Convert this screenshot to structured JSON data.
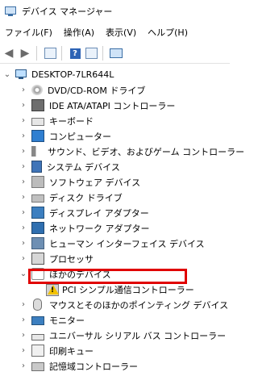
{
  "window": {
    "title": "デバイス マネージャー",
    "icon": "device-manager-icon"
  },
  "menu": [
    "ファイル(F)",
    "操作(A)",
    "表示(V)",
    "ヘルプ(H)"
  ],
  "toolbar": {
    "back_icon": "back-arrow-icon",
    "forward_icon": "forward-arrow-icon",
    "view_icon": "properties-icon",
    "help_label": "?",
    "scan_icon": "scan-hardware-icon",
    "monitor_icon": "monitor-icon"
  },
  "tree": {
    "root": "DESKTOP-7LR644L",
    "categories": [
      {
        "label": "DVD/CD-ROM ドライブ",
        "icon": "dvd-drive-icon"
      },
      {
        "label": "IDE ATA/ATAPI コントローラー",
        "icon": "ide-controller-icon"
      },
      {
        "label": "キーボード",
        "icon": "keyboard-icon"
      },
      {
        "label": "コンピューター",
        "icon": "computer-icon"
      },
      {
        "label": "サウンド、ビデオ、およびゲーム コントローラー",
        "icon": "audio-icon"
      },
      {
        "label": "システム デバイス",
        "icon": "system-device-icon"
      },
      {
        "label": "ソフトウェア デバイス",
        "icon": "software-device-icon"
      },
      {
        "label": "ディスク ドライブ",
        "icon": "disk-drive-icon"
      },
      {
        "label": "ディスプレイ アダプター",
        "icon": "display-adapter-icon"
      },
      {
        "label": "ネットワーク アダプター",
        "icon": "network-adapter-icon"
      },
      {
        "label": "ヒューマン インターフェイス デバイス",
        "icon": "hid-icon"
      },
      {
        "label": "プロセッサ",
        "icon": "processor-icon"
      },
      {
        "label": "ほかのデバイス",
        "icon": "other-devices-icon",
        "expanded": true,
        "children": [
          {
            "label": "PCI シンプル通信コントローラー",
            "icon": "warning-device-icon"
          }
        ]
      },
      {
        "label": "マウスとそのほかのポインティング デバイス",
        "icon": "mouse-icon"
      },
      {
        "label": "モニター",
        "icon": "monitor-icon"
      },
      {
        "label": "ユニバーサル シリアル バス コントローラー",
        "icon": "usb-icon"
      },
      {
        "label": "印刷キュー",
        "icon": "print-queue-icon"
      },
      {
        "label": "記憶域コントローラー",
        "icon": "storage-controller-icon"
      }
    ]
  },
  "highlight_color": "#e00000"
}
